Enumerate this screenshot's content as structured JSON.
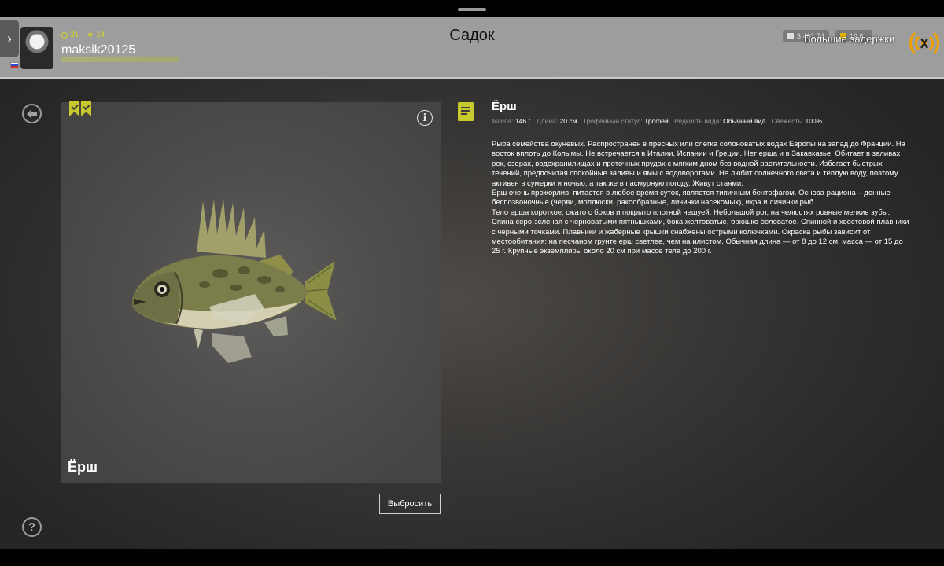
{
  "header": {
    "title": "Садок",
    "username": "maksik20125",
    "stat_level": "31",
    "stat_rating": "14",
    "wallet_silver": "3 401 74",
    "wallet_gold": "19 6..",
    "lag_warning": "Большие задержки"
  },
  "card": {
    "fish_name": "Ёрш",
    "bookmarks": [
      "check-bookmark-icon",
      "check-bookmark-icon"
    ]
  },
  "details": {
    "title": "Ёрш",
    "mass_label": "Масса:",
    "mass_value": "146 г",
    "length_label": "Длина:",
    "length_value": "20 см",
    "trophy_label": "Трофейный статус:",
    "trophy_value": "Трофей",
    "rarity_label": "Редкость вида:",
    "rarity_value": "Обычный вид",
    "freshness_label": "Свежесть:",
    "freshness_value": "100%",
    "description_1": "Рыба семейства окуневых. Распространен в пресных или слегка солоноватых водах Европы на запад до Франции. На восток вплоть до Колымы. Не встречается в Италии, Испании и Греции. Нет ерша и в Закавказье. Обитает в заливах рек, озерах, водохранилищах и проточных прудах с мягким дном без водной растительности. Избегает быстрых течений, предпочитая спокойные заливы и ямы с водоворотами. Не любит солнечного света и теплую воду, поэтому активен в сумерки и ночью, а так же в пасмурную погоду. Живут стаями.",
    "description_2": "Ерш очень прожорлив, питается в любое время суток, является типичным бентофагом. Основа рациона – донные беспозвоночные (черви, моллюски, ракообразные, личинки насекомых), икра и личинки рыб.",
    "description_3": "Тело ерша короткое, сжато с боков и покрыто плотной чешуей. Небольшой рот, на челюстях ровные мелкие зубы. Спина серо-зеленая с черноватыми пятнышками, бока желтоватые, брюшко беловатое. Спинной и хвостовой плавники с черными точками. Плавники и жаберные крышки снабжены острыми колючками. Окраска рыбы зависит от местообитания: на песчаном грунте ерш светлее, чем на илистом. Обычная длина — от 8 до 12 см, масса — от 15 до 25 г. Крупные экземпляры около 20 см при массе тела до 200 г."
  },
  "actions": {
    "drop_label": "Выбросить"
  },
  "colors": {
    "accent_yellow": "#c7c92c",
    "header_bg": "#9d9d9d",
    "lag_orange": "#f0a000"
  }
}
